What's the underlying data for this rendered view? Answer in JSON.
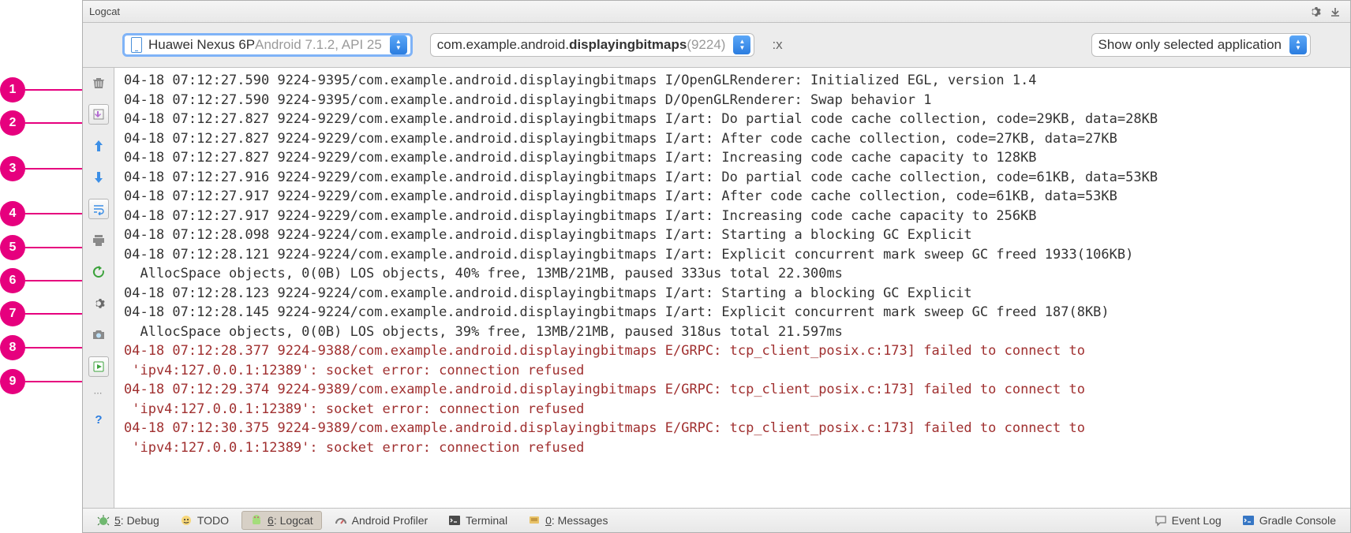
{
  "panel_title": "Logcat",
  "callouts": [
    "1",
    "2",
    "3",
    "4",
    "5",
    "6",
    "7",
    "8",
    "9"
  ],
  "device": {
    "name": "Huawei Nexus 6P ",
    "details": "Android 7.1.2, API 25"
  },
  "process": {
    "pkg_prefix": "com.example.android.",
    "pkg_bold": "displayingbitmaps",
    "pid": " (9224)"
  },
  "regex_hint": ":x",
  "filter_label": "Show only selected application",
  "logs": [
    {
      "level": "I",
      "text": "04-18 07:12:27.590 9224-9395/com.example.android.displayingbitmaps I/OpenGLRenderer: Initialized EGL, version 1.4"
    },
    {
      "level": "D",
      "text": "04-18 07:12:27.590 9224-9395/com.example.android.displayingbitmaps D/OpenGLRenderer: Swap behavior 1"
    },
    {
      "level": "I",
      "text": "04-18 07:12:27.827 9224-9229/com.example.android.displayingbitmaps I/art: Do partial code cache collection, code=29KB, data=28KB"
    },
    {
      "level": "I",
      "text": "04-18 07:12:27.827 9224-9229/com.example.android.displayingbitmaps I/art: After code cache collection, code=27KB, data=27KB"
    },
    {
      "level": "I",
      "text": "04-18 07:12:27.827 9224-9229/com.example.android.displayingbitmaps I/art: Increasing code cache capacity to 128KB"
    },
    {
      "level": "I",
      "text": "04-18 07:12:27.916 9224-9229/com.example.android.displayingbitmaps I/art: Do partial code cache collection, code=61KB, data=53KB"
    },
    {
      "level": "I",
      "text": "04-18 07:12:27.917 9224-9229/com.example.android.displayingbitmaps I/art: After code cache collection, code=61KB, data=53KB"
    },
    {
      "level": "I",
      "text": "04-18 07:12:27.917 9224-9229/com.example.android.displayingbitmaps I/art: Increasing code cache capacity to 256KB"
    },
    {
      "level": "I",
      "text": "04-18 07:12:28.098 9224-9224/com.example.android.displayingbitmaps I/art: Starting a blocking GC Explicit"
    },
    {
      "level": "I",
      "text": "04-18 07:12:28.121 9224-9224/com.example.android.displayingbitmaps I/art: Explicit concurrent mark sweep GC freed 1933(106KB)\n  AllocSpace objects, 0(0B) LOS objects, 40% free, 13MB/21MB, paused 333us total 22.300ms"
    },
    {
      "level": "I",
      "text": "04-18 07:12:28.123 9224-9224/com.example.android.displayingbitmaps I/art: Starting a blocking GC Explicit"
    },
    {
      "level": "I",
      "text": "04-18 07:12:28.145 9224-9224/com.example.android.displayingbitmaps I/art: Explicit concurrent mark sweep GC freed 187(8KB)\n  AllocSpace objects, 0(0B) LOS objects, 39% free, 13MB/21MB, paused 318us total 21.597ms"
    },
    {
      "level": "E",
      "text": "04-18 07:12:28.377 9224-9388/com.example.android.displayingbitmaps E/GRPC: tcp_client_posix.c:173] failed to connect to\n 'ipv4:127.0.0.1:12389': socket error: connection refused"
    },
    {
      "level": "E",
      "text": "04-18 07:12:29.374 9224-9389/com.example.android.displayingbitmaps E/GRPC: tcp_client_posix.c:173] failed to connect to\n 'ipv4:127.0.0.1:12389': socket error: connection refused"
    },
    {
      "level": "E",
      "text": "04-18 07:12:30.375 9224-9389/com.example.android.displayingbitmaps E/GRPC: tcp_client_posix.c:173] failed to connect to\n 'ipv4:127.0.0.1:12389': socket error: connection refused"
    }
  ],
  "footer": {
    "debug": {
      "accel": "5",
      "label": ": Debug"
    },
    "todo": "TODO",
    "logcat": {
      "accel": "6",
      "label": ": Logcat"
    },
    "profiler": "Android Profiler",
    "terminal": "Terminal",
    "messages": {
      "accel": "0",
      "label": ": Messages"
    },
    "event_log": "Event Log",
    "gradle": "Gradle Console"
  }
}
